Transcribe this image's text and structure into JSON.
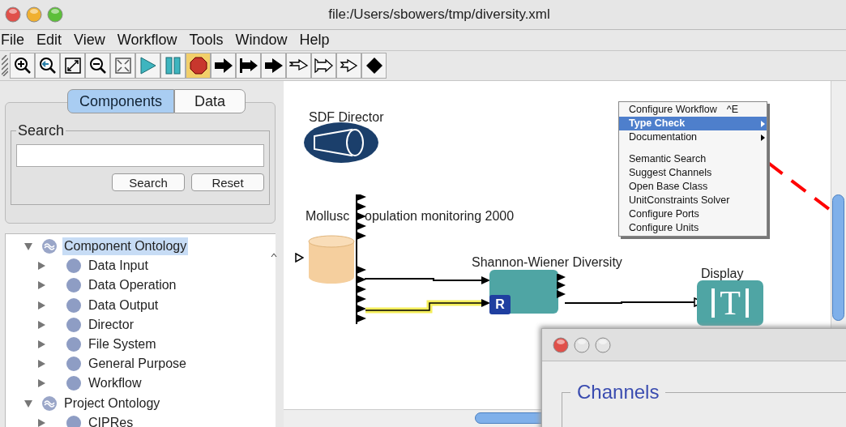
{
  "window": {
    "title": "file:/Users/sbowers/tmp/diversity.xml"
  },
  "menu_bar": [
    "File",
    "Edit",
    "View",
    "Workflow",
    "Tools",
    "Window",
    "Help"
  ],
  "toolbar": [
    {
      "kind": "zoom-in",
      "selected": false
    },
    {
      "kind": "zoom-reset",
      "selected": false
    },
    {
      "kind": "zoom-fit",
      "selected": false
    },
    {
      "kind": "zoom-out",
      "selected": false
    },
    {
      "kind": "fullscreen",
      "selected": false
    },
    {
      "kind": "run",
      "selected": false
    },
    {
      "kind": "pause",
      "selected": false
    },
    {
      "kind": "stop",
      "selected": true
    },
    {
      "kind": "arrow",
      "selected": false
    },
    {
      "kind": "bar-arrow",
      "selected": false
    },
    {
      "kind": "short-arrow",
      "selected": false
    },
    {
      "kind": "open-arrow",
      "selected": false
    },
    {
      "kind": "open-bar-arrow",
      "selected": false
    },
    {
      "kind": "open-short-arrow",
      "selected": false
    },
    {
      "kind": "diamond",
      "selected": false
    }
  ],
  "sidebar": {
    "tabs": [
      {
        "label": "Components",
        "selected": true
      },
      {
        "label": "Data",
        "selected": false
      }
    ],
    "search": {
      "legend": "Search",
      "buttons": [
        "Search",
        "Reset"
      ]
    },
    "tree": [
      {
        "label": "Component Ontology",
        "kind": "ontology",
        "expanded": true,
        "selected": true,
        "children": [
          {
            "label": "Data Input",
            "kind": "category",
            "expanded": false,
            "selected": false
          },
          {
            "label": "Data Operation",
            "kind": "category",
            "expanded": false,
            "selected": false
          },
          {
            "label": "Data Output",
            "kind": "category",
            "expanded": false,
            "selected": false
          },
          {
            "label": "Director",
            "kind": "category",
            "expanded": false,
            "selected": false
          },
          {
            "label": "File System",
            "kind": "category",
            "expanded": false,
            "selected": false
          },
          {
            "label": "General Purpose",
            "kind": "category",
            "expanded": false,
            "selected": false
          },
          {
            "label": "Workflow",
            "kind": "category",
            "expanded": false,
            "selected": false
          }
        ]
      },
      {
        "label": "Project Ontology",
        "kind": "ontology",
        "expanded": true,
        "selected": false,
        "children": [
          {
            "label": "CIPRes",
            "kind": "category",
            "expanded": false,
            "selected": false
          }
        ]
      }
    ]
  },
  "canvas": {
    "director": {
      "label": "SDF Director"
    },
    "source": {
      "label_parts": [
        "Mollusc",
        "opulation monitoring 2000"
      ]
    },
    "actor": {
      "label": "Shannon-Wiener Diversity",
      "badge": "R"
    },
    "display": {
      "label": "Display",
      "glyph": "T"
    },
    "context_menu": [
      {
        "kind": "item",
        "label": "Configure Workflow",
        "shortcut": "^E",
        "submenu": false,
        "selected": false
      },
      {
        "kind": "item",
        "label": "Type Check",
        "submenu": true,
        "selected": true
      },
      {
        "kind": "item",
        "label": "Documentation",
        "submenu": true,
        "selected": false
      },
      {
        "kind": "separator"
      },
      {
        "kind": "item",
        "label": "Semantic Search",
        "submenu": false,
        "selected": false
      },
      {
        "kind": "item",
        "label": "Suggest Channels",
        "submenu": false,
        "selected": false
      },
      {
        "kind": "item",
        "label": "Open Base Class",
        "submenu": false,
        "selected": false
      },
      {
        "kind": "item",
        "label": "UnitConstraints Solver",
        "submenu": false,
        "selected": false
      },
      {
        "kind": "item",
        "label": "Configure Ports",
        "submenu": false,
        "selected": false
      },
      {
        "kind": "item",
        "label": "Configure Units",
        "submenu": false,
        "selected": false
      }
    ]
  },
  "channels_window": {
    "group_title": "Channels"
  }
}
